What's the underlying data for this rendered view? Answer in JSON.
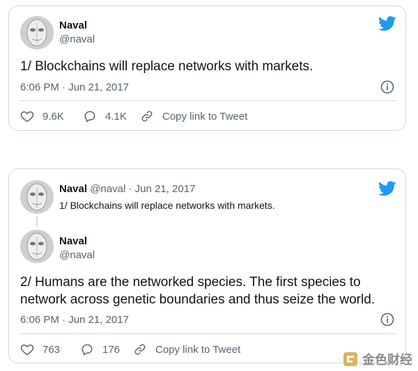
{
  "tweet1": {
    "author_name": "Naval",
    "author_handle": "@naval",
    "text": "1/ Blockchains will replace networks with markets.",
    "timestamp": "6:06 PM · Jun 21, 2017",
    "likes": "9.6K",
    "replies": "4.1K",
    "copy_link_label": "Copy link to Tweet"
  },
  "tweet2": {
    "quoted": {
      "author_name": "Naval",
      "author_handle": "@naval",
      "date": "· Jun 21, 2017",
      "text": "1/ Blockchains will replace networks with markets."
    },
    "author_name": "Naval",
    "author_handle": "@naval",
    "text_line1": "2/ Humans are the networked species. The first species to",
    "text_line2": "network across genetic boundaries and thus seize the world.",
    "timestamp": "6:06 PM · Jun 21, 2017",
    "likes": "763",
    "replies": "176",
    "copy_link_label": "Copy link to Tweet"
  },
  "watermark": {
    "text": "金色财经"
  },
  "colors": {
    "twitter_blue": "#1d9bf0",
    "text_secondary": "#536471",
    "border": "#cfd9de"
  },
  "icons": [
    "twitter-bird-icon",
    "info-icon",
    "heart-icon",
    "reply-icon",
    "link-icon",
    "watermark-logo-icon"
  ]
}
